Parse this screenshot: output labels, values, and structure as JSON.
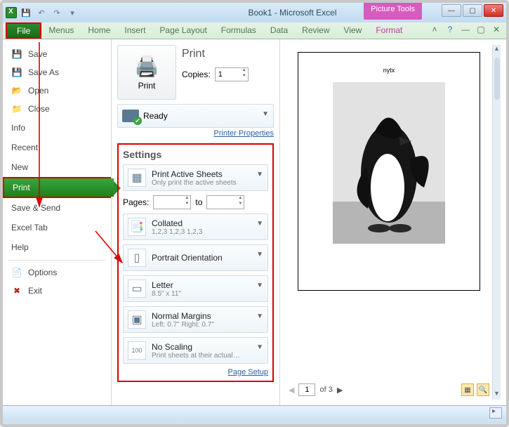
{
  "titlebar": {
    "title": "Book1 - Microsoft Excel",
    "tool_tab": "Picture Tools"
  },
  "ribbon": {
    "file": "File",
    "tabs": [
      "Menus",
      "Home",
      "Insert",
      "Page Layout",
      "Formulas",
      "Data",
      "Review",
      "View"
    ],
    "context_tab": "Format"
  },
  "backstage_nav": {
    "save": "Save",
    "save_as": "Save As",
    "open": "Open",
    "close": "Close",
    "info": "Info",
    "recent": "Recent",
    "new": "New",
    "print": "Print",
    "save_send": "Save & Send",
    "excel_tab": "Excel Tab",
    "help": "Help",
    "options": "Options",
    "exit": "Exit"
  },
  "print_panel": {
    "big_button": "Print",
    "heading": "Print",
    "copies_label": "Copies:",
    "copies_value": "1",
    "printer_status": "Ready",
    "printer_props": "Printer Properties",
    "settings_heading": "Settings",
    "active_sheets": {
      "t1": "Print Active Sheets",
      "t2": "Only print the active sheets"
    },
    "pages_label": "Pages:",
    "pages_from": "",
    "to_label": "to",
    "pages_to": "",
    "collated": {
      "t1": "Collated",
      "t2": "1,2,3   1,2,3   1,2,3"
    },
    "orientation": "Portrait Orientation",
    "paper": {
      "t1": "Letter",
      "t2": "8.5\" x 11\""
    },
    "margins": {
      "t1": "Normal Margins",
      "t2": "Left: 0.7\"   Right: 0.7\""
    },
    "scaling": {
      "t1": "No Scaling",
      "t2": "Print sheets at their actual…"
    },
    "page_setup": "Page Setup"
  },
  "preview": {
    "page_label_text": "nytx",
    "current_page": "1",
    "page_total": "of 3"
  }
}
